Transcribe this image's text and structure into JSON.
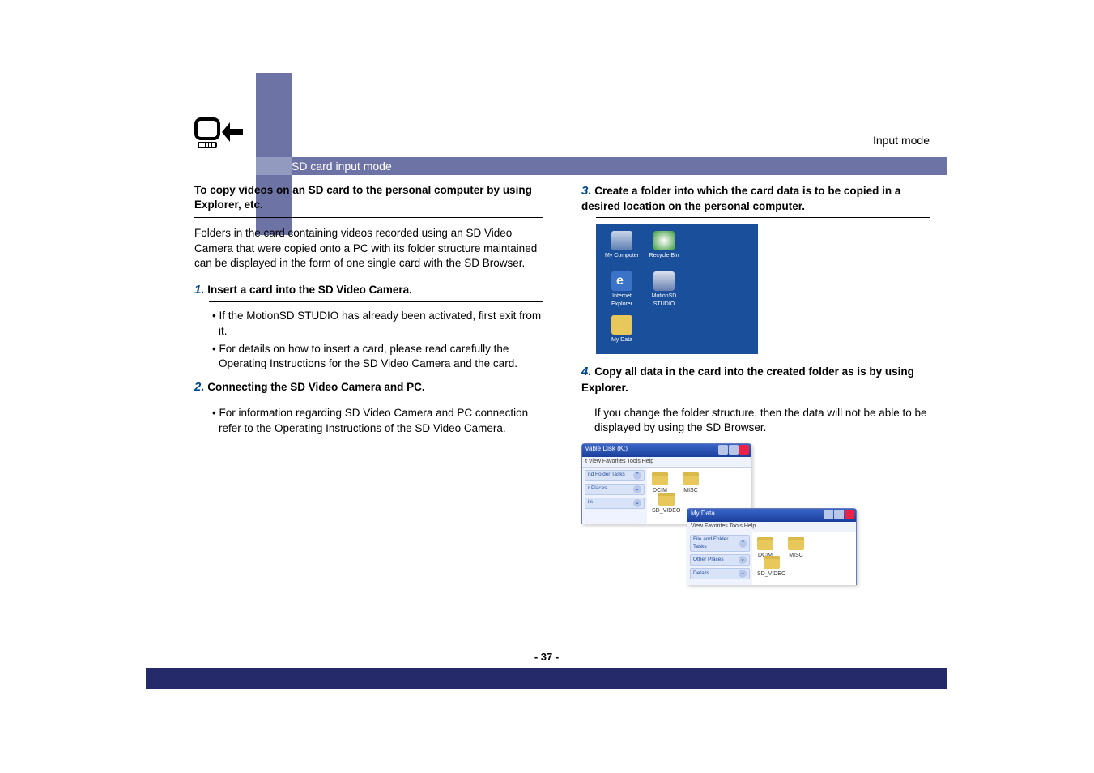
{
  "header": {
    "mode_label": "Input mode",
    "title_bar": "SD card input mode"
  },
  "left_col": {
    "bold_heading": "To copy videos on an SD card to the personal computer by using Explorer, etc.",
    "intro_para": "Folders in the card containing videos recorded using an SD Video Camera that were copied onto a PC with its folder structure maintained can be displayed in the form of one single card with the SD Browser.",
    "step1_num": "1.",
    "step1_head": "Insert a card into the SD Video Camera.",
    "step1_b1": "• If the MotionSD STUDIO has already been activated, first exit from it.",
    "step1_b2": "• For details on how to insert a card, please read carefully the Operating Instructions for the SD Video Camera and the card.",
    "step2_num": "2.",
    "step2_head": "Connecting the SD Video Camera and PC.",
    "step2_b1": "• For information regarding SD Video Camera and PC connection refer to the Operating Instructions of the SD Video Camera."
  },
  "right_col": {
    "step3_num": "3.",
    "step3_head": "Create a folder into which the card data is to be copied in a desired location on the personal computer.",
    "step4_num": "4.",
    "step4_head": "Copy all data in the card into the created folder as is by using Explorer.",
    "step4_note": "If you change the folder structure, then the data will not be able to be displayed by using the SD Browser."
  },
  "desktop": {
    "my_computer": "My Computer",
    "recycle_bin": "Recycle Bin",
    "ie": "Internet Explorer",
    "motionsd": "MotionSD STUDIO",
    "my_data": "My Data"
  },
  "win1": {
    "title": "vable Disk (K:)",
    "menu": "t   View   Favorites   Tools   Help",
    "sp1": "nd Folder Tasks",
    "sp2": "r Places",
    "sp3": "ils",
    "f1": "DCIM",
    "f2": "SD_VIDEO",
    "f3": "MISC"
  },
  "win2": {
    "title": "My Data",
    "menu": "View   Favorites   Tools   Help",
    "sp1": "File and Folder Tasks",
    "sp2": "Other Places",
    "sp3": "Details",
    "f1": "DCIM",
    "f2": "SD_VIDEO",
    "f3": "MISC"
  },
  "page_number": "- 37 -"
}
